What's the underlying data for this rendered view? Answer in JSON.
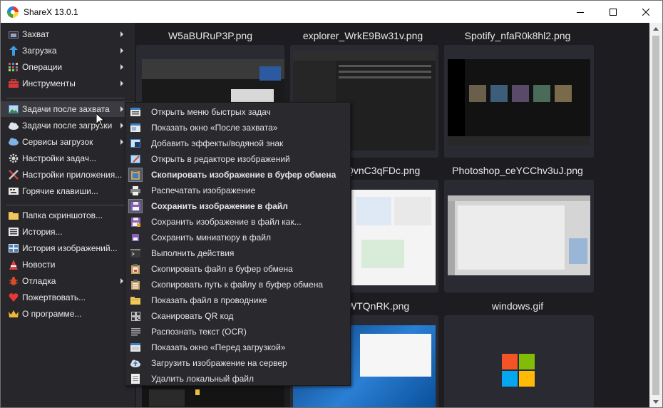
{
  "window": {
    "title": "ShareX 13.0.1"
  },
  "sidebar": {
    "items": [
      {
        "label": "Захват",
        "icon": "camera-icon",
        "arrow": true
      },
      {
        "label": "Загрузка",
        "icon": "upload-arrow-icon",
        "arrow": true
      },
      {
        "label": "Операции",
        "icon": "grid-dots-icon",
        "arrow": true
      },
      {
        "label": "Инструменты",
        "icon": "toolbox-icon",
        "arrow": true
      },
      {
        "label": "Задачи после захвата",
        "icon": "image-task-icon",
        "arrow": true
      },
      {
        "label": "Задачи после загрузки",
        "icon": "cloud-icon",
        "arrow": true
      },
      {
        "label": "Сервисы загрузок",
        "icon": "cloud-server-icon",
        "arrow": true
      },
      {
        "label": "Настройки задач...",
        "icon": "gear-icon",
        "arrow": false
      },
      {
        "label": "Настройки приложения...",
        "icon": "wrench-screwdriver-icon",
        "arrow": false
      },
      {
        "label": "Горячие клавиши...",
        "icon": "keyboard-icon",
        "arrow": false
      },
      {
        "label": "Папка скриншотов...",
        "icon": "folder-icon",
        "arrow": false
      },
      {
        "label": "История...",
        "icon": "history-list-icon",
        "arrow": false
      },
      {
        "label": "История изображений...",
        "icon": "image-history-icon",
        "arrow": false
      },
      {
        "label": "Новости",
        "icon": "megaphone-icon",
        "arrow": false
      },
      {
        "label": "Отладка",
        "icon": "bug-icon",
        "arrow": true
      },
      {
        "label": "Пожертвовать...",
        "icon": "heart-icon",
        "arrow": false
      },
      {
        "label": "О программе...",
        "icon": "crown-icon",
        "arrow": false
      }
    ]
  },
  "gallery": {
    "thumbnails": [
      {
        "title": "W5aBURuP3P.png"
      },
      {
        "title": "explorer_WrkE9Bw31v.png"
      },
      {
        "title": "Spotify_nfaR0k8hl2.png"
      },
      {
        "title": "ShareX_SQvnC3qFDc.png",
        "visible_title": "QvnC3qFDc.png"
      },
      {
        "title": "Photoshop_ceYCChv3uJ.png"
      },
      {
        "title": "WTQnRK.png"
      },
      {
        "title": "windows.gif"
      }
    ]
  },
  "submenu": {
    "items": [
      {
        "label": "Открыть меню быстрых задач",
        "icon": "quick-menu-icon",
        "checked": false,
        "bold": false
      },
      {
        "label": "Показать окно «После захвата»",
        "icon": "window-icon",
        "checked": false,
        "bold": false
      },
      {
        "label": "Добавить эффекты/водяной знак",
        "icon": "effects-icon",
        "checked": false,
        "bold": false
      },
      {
        "label": "Открыть в редакторе изображений",
        "icon": "image-editor-icon",
        "checked": false,
        "bold": false
      },
      {
        "label": "Скопировать изображение в буфер обмена",
        "icon": "clipboard-image-icon",
        "checked": true,
        "bold": true
      },
      {
        "label": "Распечатать изображение",
        "icon": "printer-icon",
        "checked": false,
        "bold": false
      },
      {
        "label": "Сохранить изображение в файл",
        "icon": "floppy-disk-icon",
        "checked": true,
        "bold": true
      },
      {
        "label": "Сохранить изображение в файл как...",
        "icon": "floppy-disk-as-icon",
        "checked": false,
        "bold": false
      },
      {
        "label": "Сохранить миниатюру в файл",
        "icon": "thumbnail-save-icon",
        "checked": false,
        "bold": false
      },
      {
        "label": "Выполнить действия",
        "icon": "terminal-icon",
        "checked": false,
        "bold": false
      },
      {
        "label": "Скопировать файл в буфер обмена",
        "icon": "clipboard-file-icon",
        "checked": false,
        "bold": false
      },
      {
        "label": "Скопировать путь к файлу в буфер обмена",
        "icon": "clipboard-path-icon",
        "checked": false,
        "bold": false
      },
      {
        "label": "Показать файл в проводнике",
        "icon": "folder-open-icon",
        "checked": false,
        "bold": false
      },
      {
        "label": "Сканировать QR код",
        "icon": "qr-code-icon",
        "checked": false,
        "bold": false
      },
      {
        "label": "Распознать текст (OCR)",
        "icon": "text-lines-icon",
        "checked": false,
        "bold": false
      },
      {
        "label": "Показать окно «Перед загрузкой»",
        "icon": "window-upload-icon",
        "checked": false,
        "bold": false
      },
      {
        "label": "Загрузить изображение на сервер",
        "icon": "cloud-upload-icon",
        "checked": false,
        "bold": false
      },
      {
        "label": "Удалить локальный файл",
        "icon": "delete-file-icon",
        "checked": false,
        "bold": false
      }
    ]
  }
}
